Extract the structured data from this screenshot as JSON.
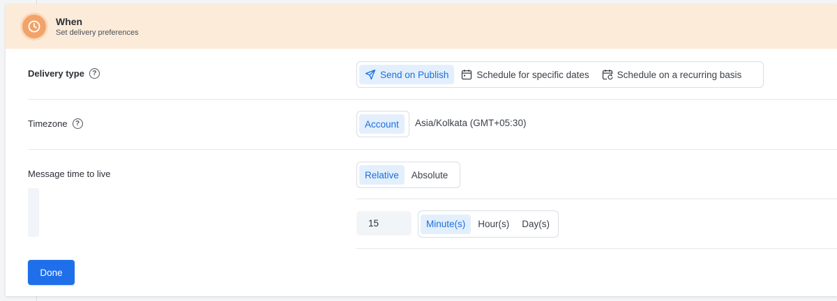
{
  "header": {
    "title": "When",
    "subtitle": "Set delivery preferences",
    "icon": "clock-icon",
    "accent_color": "#f2a36a"
  },
  "delivery_type": {
    "label": "Delivery type",
    "help_glyph": "?",
    "options": [
      {
        "label": "Send on Publish",
        "icon": "send-icon",
        "selected": true
      },
      {
        "label": "Schedule for specific dates",
        "icon": "calendar-icon",
        "selected": false
      },
      {
        "label": "Schedule on a recurring basis",
        "icon": "recurring-calendar-icon",
        "selected": false
      }
    ]
  },
  "timezone": {
    "label": "Timezone",
    "help_glyph": "?",
    "mode": "Account",
    "value": "Asia/Kolkata (GMT+05:30)"
  },
  "ttl": {
    "label": "Message time to live",
    "modes": [
      {
        "label": "Relative",
        "selected": true
      },
      {
        "label": "Absolute",
        "selected": false
      }
    ],
    "value": "15",
    "units": [
      {
        "label": "Minute(s)",
        "selected": true
      },
      {
        "label": "Hour(s)",
        "selected": false
      },
      {
        "label": "Day(s)",
        "selected": false
      }
    ]
  },
  "actions": {
    "done_label": "Done",
    "primary_color": "#1f6feb"
  }
}
